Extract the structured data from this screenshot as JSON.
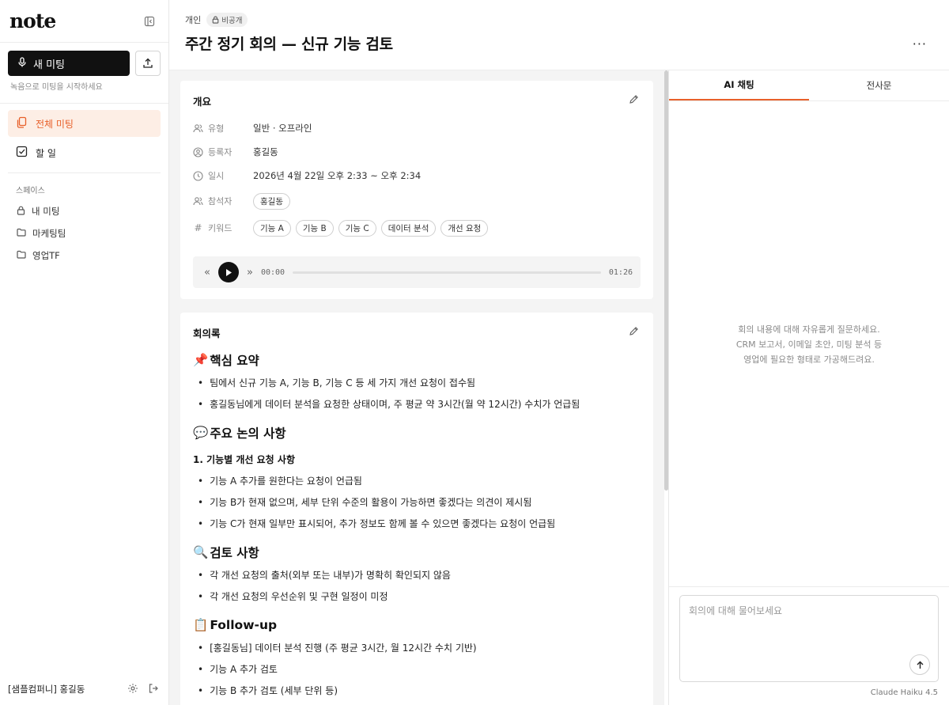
{
  "app": {
    "logo": "note"
  },
  "sidebar": {
    "new_meeting_label": "새 미팅",
    "new_meeting_hint": "녹음으로 미팅을 시작하세요",
    "nav": [
      {
        "label": "전체 미팅",
        "icon": "copy-icon",
        "active": true
      },
      {
        "label": "할 일",
        "icon": "checkbox-icon",
        "active": false
      }
    ],
    "spaces_title": "스페이스",
    "spaces": [
      {
        "label": "내 미팅",
        "icon": "lock-icon"
      },
      {
        "label": "마케팅팀",
        "icon": "folder-icon"
      },
      {
        "label": "영업TF",
        "icon": "folder-icon"
      }
    ],
    "footer_user": "[샘플컴퍼니] 홍길동"
  },
  "header": {
    "crumb": "개인",
    "visibility": "비공개",
    "title": "주간 정기 회의 — 신규 기능 검토",
    "more": "···"
  },
  "overview": {
    "title": "개요",
    "type_label": "유형",
    "type_value": "일반 · 오프라인",
    "registrant_label": "등록자",
    "registrant_value": "홍길동",
    "datetime_label": "일시",
    "datetime_value": "2026년 4월 22일 오후 2:33 ~ 오후 2:34",
    "attendees_label": "참석자",
    "attendees": [
      "홍길동"
    ],
    "keywords_label": "키워드",
    "keywords": [
      "기능 A",
      "기능 B",
      "기능 C",
      "데이터 분석",
      "개선 요청"
    ],
    "player": {
      "current": "00:00",
      "total": "01:26",
      "rewind": "«",
      "forward": "»"
    }
  },
  "minutes": {
    "title": "회의록",
    "sections": {
      "summary": {
        "emoji": "📌",
        "heading": "핵심 요약",
        "items": [
          "팀에서 신규 기능 A, 기능 B, 기능 C 등 세 가지 개선 요청이 접수됨",
          "홍길동님에게 데이터 분석을 요청한 상태이며, 주 평균 약 3시간(월 약 12시간) 수치가 언급됨"
        ]
      },
      "discussion": {
        "emoji": "💬",
        "heading": "주요 논의 사항",
        "subheading": "1. 기능별 개선 요청 사항",
        "items": [
          "기능 A 추가를 원한다는 요청이 언급됨",
          "기능 B가 현재 없으며, 세부 단위 수준의 활용이 가능하면 좋겠다는 의견이 제시됨",
          "기능 C가 현재 일부만 표시되어, 추가 정보도 함께 볼 수 있으면 좋겠다는 요청이 언급됨"
        ]
      },
      "review": {
        "emoji": "🔍",
        "heading": "검토 사항",
        "items": [
          "각 개선 요청의 출처(외부 또는 내부)가 명확히 확인되지 않음",
          "각 개선 요청의 우선순위 및 구현 일정이 미정"
        ]
      },
      "followup": {
        "emoji": "📋",
        "heading": "Follow-up",
        "items": [
          "[홍길동님] 데이터 분석 진행 (주 평균 3시간, 월 12시간 수치 기반)",
          "기능 A 추가 검토",
          "기능 B 추가 검토 (세부 단위 등)"
        ]
      }
    }
  },
  "right_panel": {
    "tabs": [
      {
        "label": "AI 채팅",
        "active": true
      },
      {
        "label": "전사문",
        "active": false
      }
    ],
    "hint_lines": [
      "회의 내용에 대해 자유롭게 질문하세요.",
      "CRM 보고서, 이메일 초안, 미팅 분석 등",
      "영업에 필요한 형태로 가공해드려요."
    ],
    "input_placeholder": "회의에 대해 물어보세요",
    "model": "Claude Haiku 4.5"
  },
  "colors": {
    "accent": "#e8602a",
    "accent_bg": "#fdeee5",
    "primary_button": "#111111"
  }
}
